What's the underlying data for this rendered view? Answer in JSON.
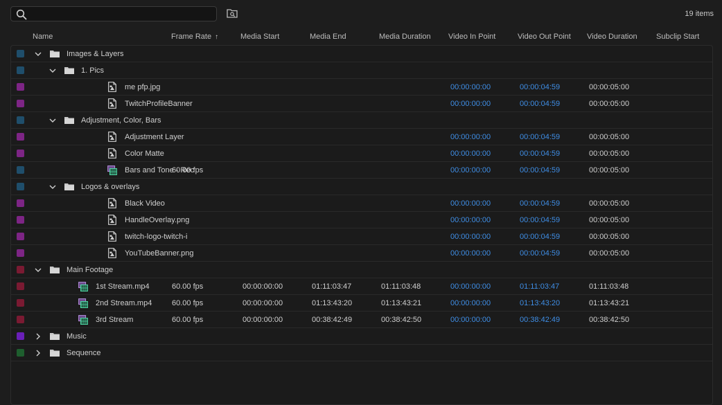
{
  "search": {
    "value": "",
    "placeholder": ""
  },
  "items_count": "19 items",
  "columns": [
    {
      "label": "Name"
    },
    {
      "label": "Frame Rate",
      "sort": "ascending"
    },
    {
      "label": "Media Start"
    },
    {
      "label": "Media End"
    },
    {
      "label": "Media Duration"
    },
    {
      "label": "Video In Point"
    },
    {
      "label": "Video Out Point"
    },
    {
      "label": "Video Duration"
    },
    {
      "label": "Subclip Start"
    }
  ],
  "rows": [
    {
      "type": "folder",
      "depth": 0,
      "expanded": true,
      "label_color": "#1f4e6b",
      "name": "Images & Layers",
      "frame_rate": "",
      "media_start": "",
      "media_end": "",
      "media_duration": "",
      "video_in": "",
      "video_out": "",
      "video_duration": "",
      "subclip_start": ""
    },
    {
      "type": "folder",
      "depth": 1,
      "expanded": true,
      "label_color": "#1f4e6b",
      "name": "1. Pics",
      "frame_rate": "",
      "media_start": "",
      "media_end": "",
      "media_duration": "",
      "video_in": "",
      "video_out": "",
      "video_duration": "",
      "subclip_start": ""
    },
    {
      "type": "still",
      "depth": 2,
      "label_color": "#7d2585",
      "name": "me pfp.jpg",
      "frame_rate": "",
      "media_start": "",
      "media_end": "",
      "media_duration": "",
      "video_in": "00:00:00:00",
      "video_out": "00:00:04:59",
      "video_duration": "00:00:05:00",
      "subclip_start": ""
    },
    {
      "type": "still",
      "depth": 2,
      "label_color": "#7d2585",
      "name": "TwitchProfileBanner",
      "frame_rate": "",
      "media_start": "",
      "media_end": "",
      "media_duration": "",
      "video_in": "00:00:00:00",
      "video_out": "00:00:04:59",
      "video_duration": "00:00:05:00",
      "subclip_start": ""
    },
    {
      "type": "folder",
      "depth": 1,
      "expanded": true,
      "label_color": "#1f4e6b",
      "name": "Adjustment, Color, Bars",
      "frame_rate": "",
      "media_start": "",
      "media_end": "",
      "media_duration": "",
      "video_in": "",
      "video_out": "",
      "video_duration": "",
      "subclip_start": ""
    },
    {
      "type": "still",
      "depth": 2,
      "label_color": "#7d2585",
      "name": "Adjustment Layer",
      "frame_rate": "",
      "media_start": "",
      "media_end": "",
      "media_duration": "",
      "video_in": "00:00:00:00",
      "video_out": "00:00:04:59",
      "video_duration": "00:00:05:00",
      "subclip_start": ""
    },
    {
      "type": "still",
      "depth": 2,
      "label_color": "#7d2585",
      "name": "Color Matte",
      "frame_rate": "",
      "media_start": "",
      "media_end": "",
      "media_duration": "",
      "video_in": "00:00:00:00",
      "video_out": "00:00:04:59",
      "video_duration": "00:00:05:00",
      "subclip_start": ""
    },
    {
      "type": "clip",
      "depth": 2,
      "label_color": "#1f4e6b",
      "name": "Bars and Tone - Rec",
      "frame_rate": "60.00 fps",
      "media_start": "",
      "media_end": "",
      "media_duration": "",
      "video_in": "00:00:00:00",
      "video_out": "00:00:04:59",
      "video_duration": "00:00:05:00",
      "subclip_start": ""
    },
    {
      "type": "folder",
      "depth": 1,
      "expanded": true,
      "label_color": "#1f4e6b",
      "name": "Logos & overlays",
      "frame_rate": "",
      "media_start": "",
      "media_end": "",
      "media_duration": "",
      "video_in": "",
      "video_out": "",
      "video_duration": "",
      "subclip_start": ""
    },
    {
      "type": "still",
      "depth": 2,
      "label_color": "#7d2585",
      "name": "Black Video",
      "frame_rate": "",
      "media_start": "",
      "media_end": "",
      "media_duration": "",
      "video_in": "00:00:00:00",
      "video_out": "00:00:04:59",
      "video_duration": "00:00:05:00",
      "subclip_start": ""
    },
    {
      "type": "still",
      "depth": 2,
      "label_color": "#7d2585",
      "name": "HandleOverlay.png",
      "frame_rate": "",
      "media_start": "",
      "media_end": "",
      "media_duration": "",
      "video_in": "00:00:00:00",
      "video_out": "00:00:04:59",
      "video_duration": "00:00:05:00",
      "subclip_start": ""
    },
    {
      "type": "still",
      "depth": 2,
      "label_color": "#7d2585",
      "name": "twitch-logo-twitch-i",
      "frame_rate": "",
      "media_start": "",
      "media_end": "",
      "media_duration": "",
      "video_in": "00:00:00:00",
      "video_out": "00:00:04:59",
      "video_duration": "00:00:05:00",
      "subclip_start": ""
    },
    {
      "type": "still",
      "depth": 2,
      "label_color": "#7d2585",
      "name": "YouTubeBanner.png",
      "frame_rate": "",
      "media_start": "",
      "media_end": "",
      "media_duration": "",
      "video_in": "00:00:00:00",
      "video_out": "00:00:04:59",
      "video_duration": "00:00:05:00",
      "subclip_start": ""
    },
    {
      "type": "folder",
      "depth": 0,
      "expanded": true,
      "label_color": "#7a1a32",
      "name": "Main Footage",
      "frame_rate": "",
      "media_start": "",
      "media_end": "",
      "media_duration": "",
      "video_in": "",
      "video_out": "",
      "video_duration": "",
      "subclip_start": ""
    },
    {
      "type": "clip",
      "depth": 1,
      "label_color": "#7a1a32",
      "name": "1st Stream.mp4",
      "frame_rate": "60.00 fps",
      "media_start": "00:00:00:00",
      "media_end": "01:11:03:47",
      "media_duration": "01:11:03:48",
      "video_in": "00:00:00:00",
      "video_out": "01:11:03:47",
      "video_duration": "01:11:03:48",
      "subclip_start": ""
    },
    {
      "type": "clip",
      "depth": 1,
      "label_color": "#7a1a32",
      "name": "2nd Stream.mp4",
      "frame_rate": "60.00 fps",
      "media_start": "00:00:00:00",
      "media_end": "01:13:43:20",
      "media_duration": "01:13:43:21",
      "video_in": "00:00:00:00",
      "video_out": "01:13:43:20",
      "video_duration": "01:13:43:21",
      "subclip_start": ""
    },
    {
      "type": "clip",
      "depth": 1,
      "label_color": "#7a1a32",
      "name": "3rd Stream",
      "frame_rate": "60.00 fps",
      "media_start": "00:00:00:00",
      "media_end": "00:38:42:49",
      "media_duration": "00:38:42:50",
      "video_in": "00:00:00:00",
      "video_out": "00:38:42:49",
      "video_duration": "00:38:42:50",
      "subclip_start": ""
    },
    {
      "type": "folder",
      "depth": 0,
      "expanded": false,
      "label_color": "#6a1fb8",
      "name": "Music",
      "frame_rate": "",
      "media_start": "",
      "media_end": "",
      "media_duration": "",
      "video_in": "",
      "video_out": "",
      "video_duration": "",
      "subclip_start": ""
    },
    {
      "type": "folder",
      "depth": 0,
      "expanded": false,
      "label_color": "#1e5e2e",
      "name": "Sequence",
      "frame_rate": "",
      "media_start": "",
      "media_end": "",
      "media_duration": "",
      "video_in": "",
      "video_out": "",
      "video_duration": "",
      "subclip_start": ""
    }
  ],
  "colors": {
    "timecode_link": "#3f8ee6",
    "text": "#cfcfcf",
    "background": "#1d1d1d"
  },
  "icons": {
    "search": "search-icon",
    "new_bin": "find-bin-icon",
    "folder": "folder-icon",
    "still": "still-image-icon",
    "clip": "video-clip-icon",
    "expanded": "chevron-down-icon",
    "collapsed": "chevron-right-icon"
  }
}
